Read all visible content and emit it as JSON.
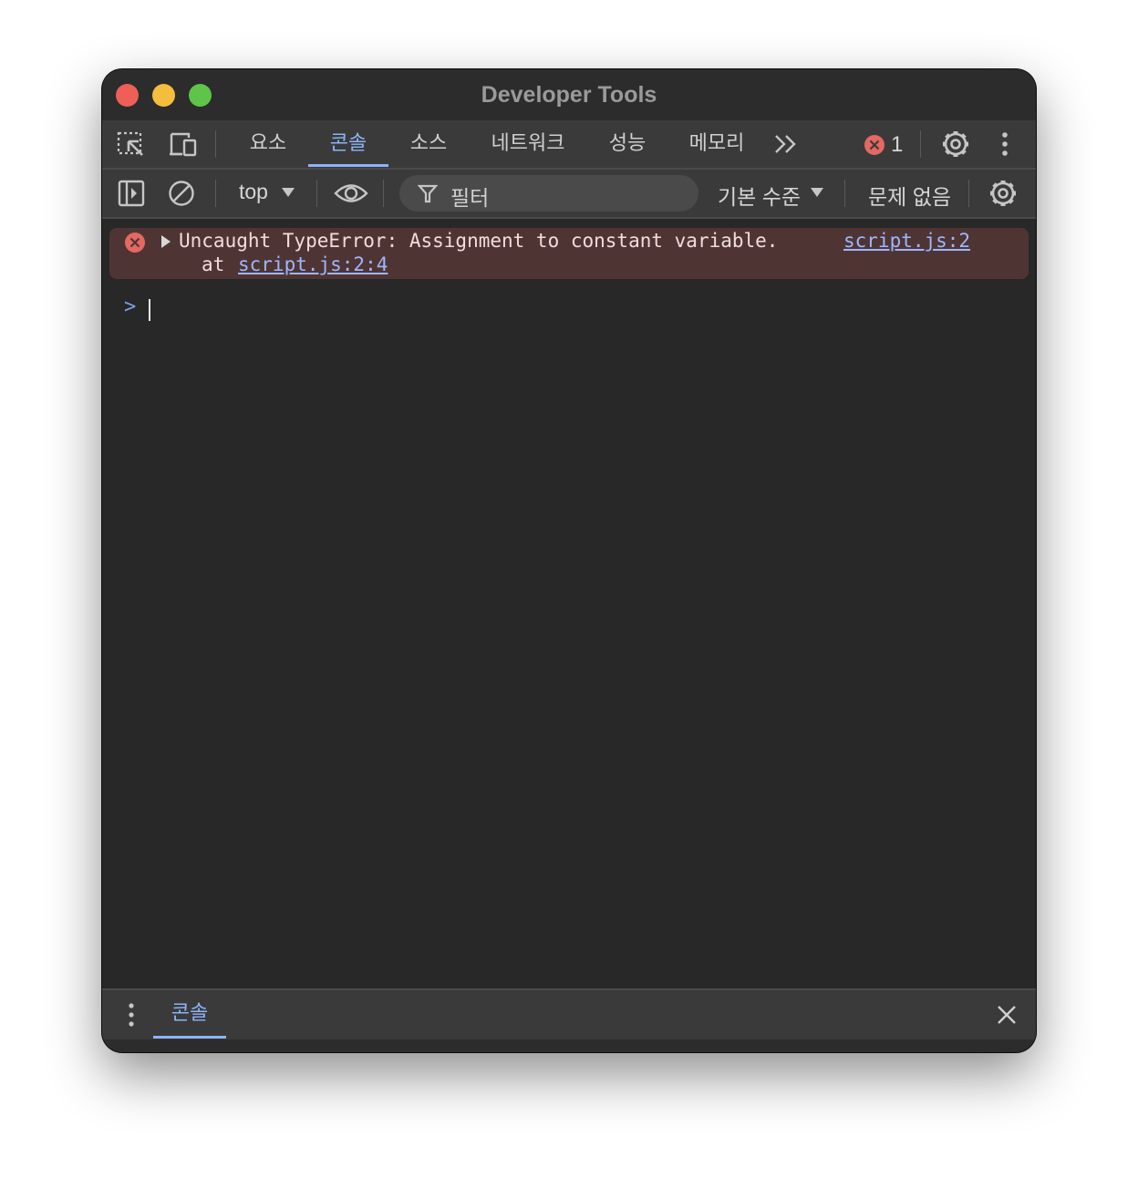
{
  "window": {
    "title": "Developer Tools"
  },
  "tabs": {
    "items": [
      {
        "label": "요소",
        "active": false
      },
      {
        "label": "콘솔",
        "active": true
      },
      {
        "label": "소스",
        "active": false
      },
      {
        "label": "네트워크",
        "active": false
      },
      {
        "label": "성능",
        "active": false
      },
      {
        "label": "메모리",
        "active": false
      }
    ],
    "more_icon": "double-chevron-right-icon",
    "error_count": "1"
  },
  "toolbar": {
    "context_label": "top",
    "filter_placeholder": "필터",
    "log_level_label": "기본 수준",
    "issues_label": "문제 없음"
  },
  "console": {
    "error_message": "Uncaught TypeError: Assignment to constant variable.",
    "error_source_link": "script.js:2",
    "stack_prefix": "at",
    "stack_link": "script.js:2:4",
    "prompt_symbol": ">"
  },
  "drawer": {
    "tab_label": "콘솔"
  },
  "colors": {
    "accent": "#8cb4f8",
    "error_bg": "#4e3534",
    "error_icon": "#e46962",
    "link": "#9fb6ff"
  }
}
